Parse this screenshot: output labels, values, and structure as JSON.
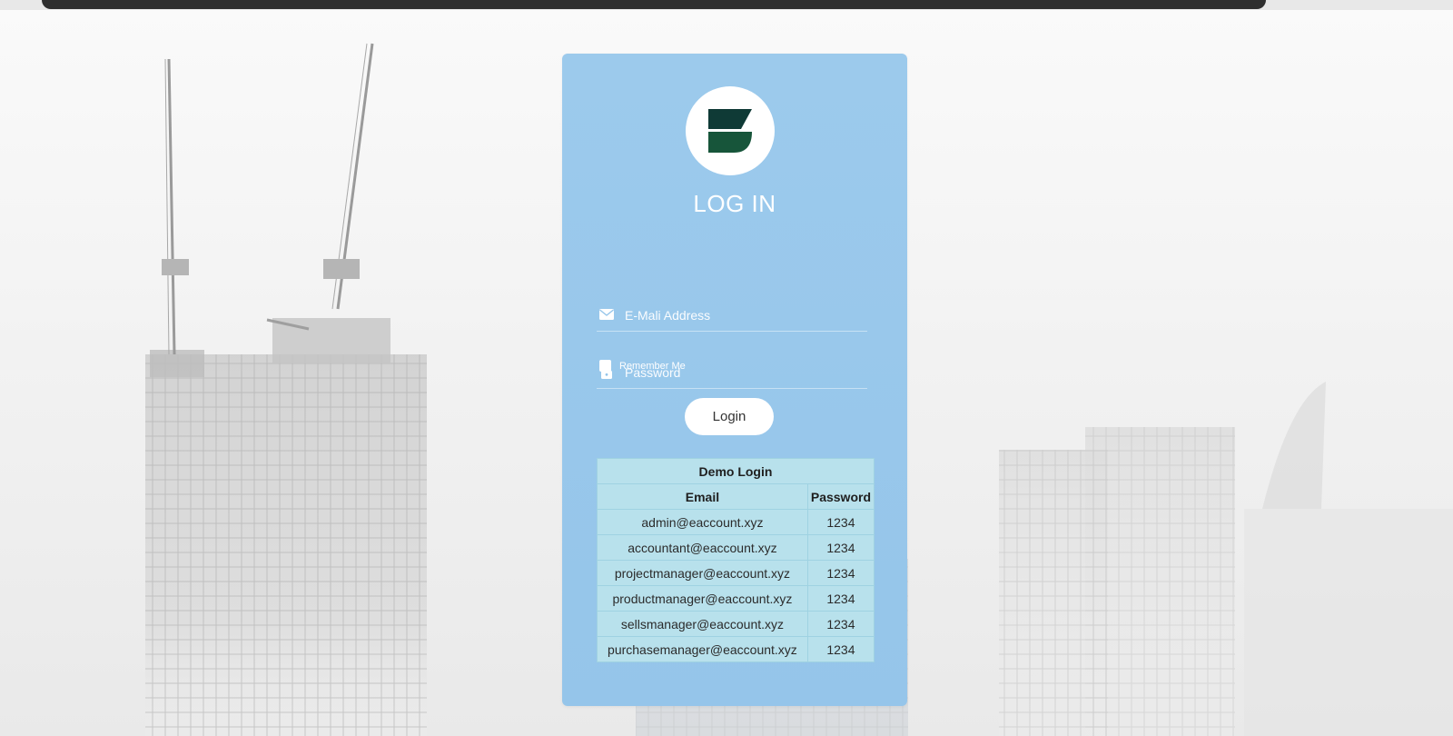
{
  "login": {
    "title": "LOG IN",
    "email_placeholder": "E-Mali Address",
    "password_placeholder": "Password",
    "remember_label": "Remember Me",
    "login_button": "Login"
  },
  "icons": {
    "logo": "brand-logo-icon",
    "email": "envelope-icon",
    "password": "lock-icon"
  },
  "colors": {
    "card_bg": "#9ccaec",
    "logo_dark": "#0f3a36",
    "logo_green": "#17553a",
    "table_bg": "#b8e1ec"
  },
  "demo_table": {
    "title": "Demo Login",
    "headers": [
      "Email",
      "Password"
    ],
    "rows": [
      [
        "admin@eaccount.xyz",
        "1234"
      ],
      [
        "accountant@eaccount.xyz",
        "1234"
      ],
      [
        "projectmanager@eaccount.xyz",
        "1234"
      ],
      [
        "productmanager@eaccount.xyz",
        "1234"
      ],
      [
        "sellsmanager@eaccount.xyz",
        "1234"
      ],
      [
        "purchasemanager@eaccount.xyz",
        "1234"
      ]
    ]
  }
}
